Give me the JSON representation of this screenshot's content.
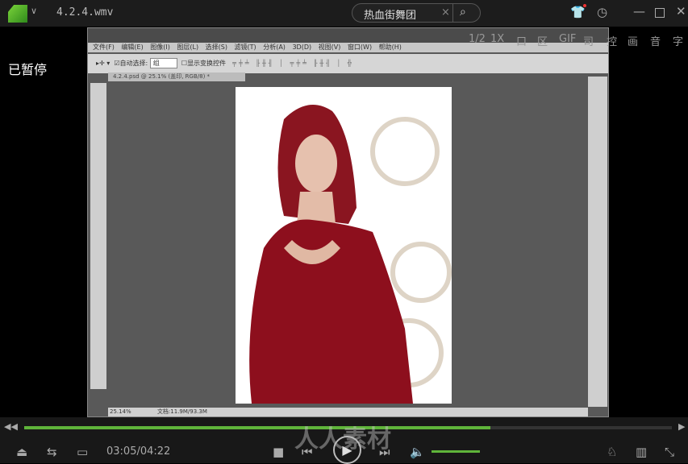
{
  "titlebar": {
    "file_name": "4.2.4.wmv",
    "search_value": "热血街舞团",
    "icons": [
      "app-logo",
      "dropdown-chevron",
      "clear-x",
      "search",
      "shirt-skin",
      "history-clock",
      "minimize",
      "maximize",
      "close"
    ]
  },
  "status_overlay": "已暂停",
  "overlay_menu": {
    "items": [
      "1/2",
      "1X",
      "吕",
      "口",
      "区",
      "GIF",
      "司",
      "控",
      "画",
      "音",
      "字"
    ]
  },
  "photoshop": {
    "menu": [
      "文件(F)",
      "编辑(E)",
      "图像(I)",
      "图层(L)",
      "选择(S)",
      "滤镜(T)",
      "分析(A)",
      "3D(D)",
      "视图(V)",
      "窗口(W)",
      "帮助(H)"
    ],
    "options": {
      "auto_select_label": "自动选择:",
      "auto_select_value": "组",
      "show_transform_label": "显示变换控件"
    },
    "doc_tab": "4.2.4.psd @ 25.1% (盖印, RGB/8) *",
    "zoom": "25.14%",
    "doc_size": "文档:11.9M/93.3M"
  },
  "player": {
    "time": "03:05/04:22",
    "progress": 0.72,
    "volume": 0.8,
    "watermark": "人人素材",
    "accent": "#5fb43a"
  }
}
